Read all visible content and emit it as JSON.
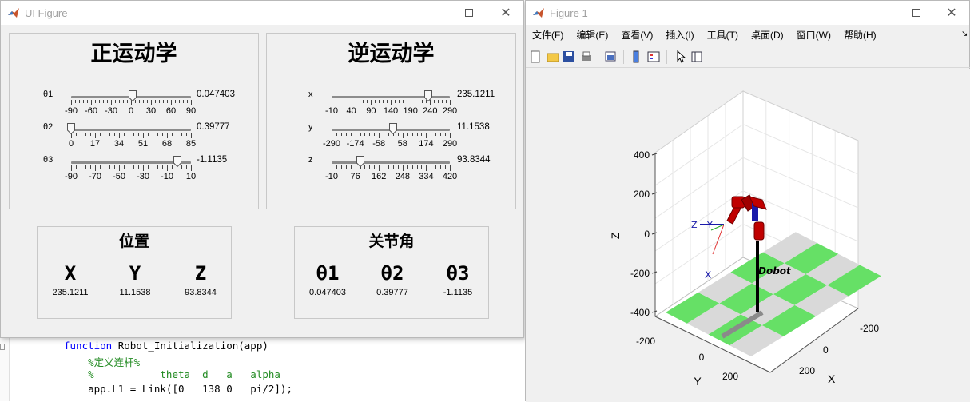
{
  "ui_figure": {
    "title": "UI Figure",
    "forward": {
      "title": "正运动学",
      "sliders": [
        {
          "label": "θ1",
          "value_text": "0.047403",
          "min": -90,
          "max": 90,
          "value_deg": 2.7,
          "ticks": [
            "-90",
            "-60",
            "-30",
            "0",
            "30",
            "60",
            "90"
          ]
        },
        {
          "label": "θ2",
          "value_text": "0.39777",
          "min": 0,
          "max": 85,
          "value_deg": 0,
          "ticks": [
            "0",
            "17",
            "34",
            "51",
            "68",
            "85"
          ]
        },
        {
          "label": "θ3",
          "value_text": "-1.1135",
          "min": -90,
          "max": 10,
          "value_deg": -1.1,
          "ticks": [
            "-90",
            "-70",
            "-50",
            "-30",
            "-10",
            "10"
          ]
        }
      ]
    },
    "inverse": {
      "title": "逆运动学",
      "sliders": [
        {
          "label": "x",
          "value_text": "235.1211",
          "min": -10,
          "max": 290,
          "value": 235.1211,
          "ticks": [
            "-10",
            "40",
            "90",
            "140",
            "190",
            "240",
            "290"
          ]
        },
        {
          "label": "y",
          "value_text": "11.1538",
          "min": -290,
          "max": 290,
          "value": 11.1538,
          "ticks": [
            "-290",
            "-174",
            "-58",
            "58",
            "174",
            "290"
          ]
        },
        {
          "label": "z",
          "value_text": "93.8344",
          "min": -10,
          "max": 420,
          "value": 93.8344,
          "ticks": [
            "-10",
            "76",
            "162",
            "248",
            "334",
            "420"
          ]
        }
      ]
    },
    "position": {
      "title": "位置",
      "items": [
        {
          "label": "X",
          "value": "235.1211"
        },
        {
          "label": "Y",
          "value": "11.1538"
        },
        {
          "label": "Z",
          "value": "93.8344"
        }
      ]
    },
    "joints": {
      "title": "关节角",
      "items": [
        {
          "label": "θ1",
          "value": "0.047403"
        },
        {
          "label": "θ2",
          "value": "0.39777"
        },
        {
          "label": "θ3",
          "value": "-1.1135"
        }
      ]
    }
  },
  "figure1": {
    "title": "Figure 1",
    "menu": [
      "文件(F)",
      "编辑(E)",
      "查看(V)",
      "插入(I)",
      "工具(T)",
      "桌面(D)",
      "窗口(W)",
      "帮助(H)"
    ],
    "toolbar_icons": [
      "new-file-icon",
      "open-folder-icon",
      "save-icon",
      "print-icon",
      "print-preview-icon",
      "colorbar-icon",
      "legend-icon",
      "pointer-icon",
      "property-editor-icon"
    ],
    "axes": {
      "z_label": "Z",
      "y_label": "Y",
      "x_label": "X",
      "z_ticks": [
        "400",
        "200",
        "0",
        "-200",
        "-400"
      ],
      "y_ticks": [
        "-200",
        "0",
        "200"
      ],
      "x_ticks": [
        "-200",
        "0",
        "200"
      ],
      "robot_name": "Dobot",
      "frame_labels": {
        "z": "Z",
        "y": "Y",
        "x": "X"
      }
    }
  },
  "editor": {
    "lines": [
      {
        "kw": "function",
        "text": " Robot_Initialization(app)"
      },
      {
        "comment": "    %定义连杆%"
      },
      {
        "comment": "    %           theta  d   a   alpha"
      },
      {
        "text": "    app.L1 = Link([0   138 0   pi/2]);"
      }
    ]
  },
  "colors": {
    "keyword": "#0000ff",
    "comment": "#228b22",
    "floor_green": "#66e066",
    "floor_gray": "#d9d9d9",
    "link_red": "#c00000",
    "joint_blue": "#1a1aaa"
  }
}
